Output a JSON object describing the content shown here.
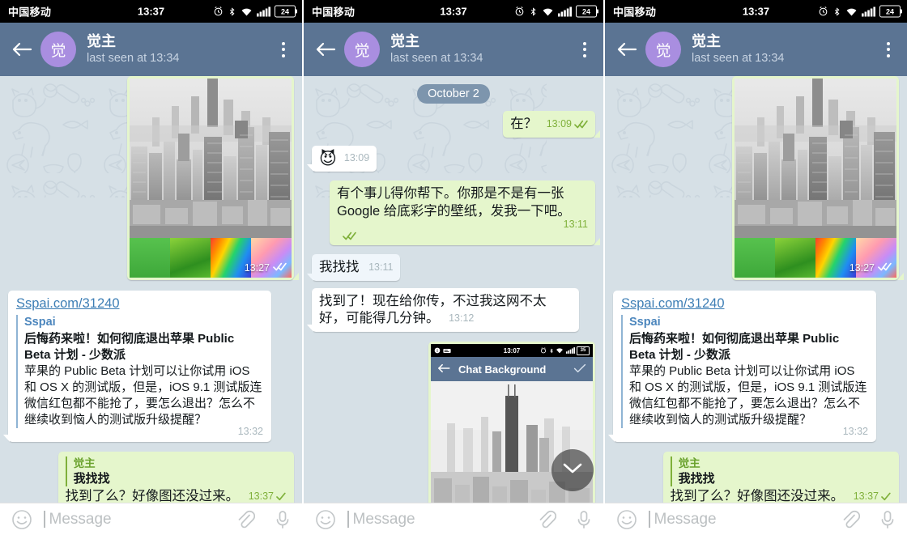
{
  "meta": {
    "app": "Telegram",
    "panels": 3,
    "colors": {
      "appbar": "#5b7493",
      "chat_bg": "#d6e0e6",
      "out_bubble": "#e5f6cc",
      "in_bubble": "#ffffff",
      "pale_bubble": "#f0f6fb",
      "avatar": "#a98ee0",
      "link_accent": "#4c86bd",
      "check_green": "#7fb03a",
      "date_chip": "#7d95ad"
    }
  },
  "statusbar": {
    "carrier": "中国移动",
    "time": "13:37",
    "battery": "24",
    "icons": [
      "alarm-icon",
      "bluetooth-icon",
      "wifi-icon",
      "signal-icon",
      "battery-icon"
    ]
  },
  "appbar": {
    "back": "back-arrow-icon",
    "avatar_initial": "觉",
    "name": "觉主",
    "status": "last seen at 13:34",
    "menu": "overflow-menu-icon"
  },
  "input": {
    "emoji_icon": "smiley-icon",
    "placeholder": "Message",
    "value": "",
    "attach_icon": "paperclip-icon",
    "voice_icon": "microphone-icon"
  },
  "panel1": {
    "photo_message": {
      "time": "13:27",
      "status": "read",
      "caption": "",
      "swatches": [
        "green-grass",
        "green-leaves",
        "rainbow-streaks",
        "pastel-prism"
      ]
    },
    "link_message": {
      "url": "Sspai.com/31240",
      "site": "Sspai",
      "title": "后悔药来啦！如何彻底退出苹果 Public Beta 计划 - 少数派",
      "description": "苹果的 Public Beta 计划可以让你试用 iOS 和 OS X 的测试版，但是，iOS 9.1 测试版连微信红包都不能抢了，要怎么退出？怎么不继续收到恼人的测试版升级提醒？",
      "time": "13:32"
    },
    "reply_message": {
      "quote_name": "觉主",
      "quote_text": "我找找",
      "text": "找到了么？好像图还没过来。",
      "time": "13:37",
      "status": "sent"
    }
  },
  "panel2": {
    "date_chip": "October 2",
    "messages": [
      {
        "id": "m1",
        "dir": "out",
        "text": "在？",
        "time": "13:09",
        "status": "read"
      },
      {
        "id": "m2",
        "dir": "in",
        "emoji": "😈",
        "time": "13:09"
      },
      {
        "id": "m3",
        "dir": "out",
        "text": "有个事儿得你帮下。你那是不是有一张 Google 给底彩字的壁纸，发我一下吧。",
        "time": "13:11",
        "status": "read"
      },
      {
        "id": "m4",
        "dir": "in",
        "text": "我找找",
        "time": "13:11"
      },
      {
        "id": "m5",
        "dir": "in",
        "text": "找到了！现在给你传，不过我这网不太好，可能得几分钟。",
        "time": "13:12"
      }
    ],
    "screenshot_message": {
      "inner_statusbar_time": "13:07",
      "inner_battery": "35",
      "inner_title": "Chat Background",
      "inner_back": "back-arrow-icon",
      "inner_confirm": "checkmark-icon"
    },
    "scroll_button": "chevron-down-icon"
  },
  "panel3": {
    "photo_message": {
      "time": "13:27",
      "status": "read"
    },
    "link_message": {
      "url": "Sspai.com/31240",
      "site": "Sspai",
      "title": "后悔药来啦！如何彻底退出苹果 Public Beta 计划 - 少数派",
      "description": "苹果的 Public Beta 计划可以让你试用 iOS 和 OS X 的测试版，但是，iOS 9.1 测试版连微信红包都不能抢了，要怎么退出？怎么不继续收到恼人的测试版升级提醒？",
      "time": "13:32"
    },
    "reply_message": {
      "quote_name": "觉主",
      "quote_text": "我找找",
      "text": "找到了么？好像图还没过来。",
      "time": "13:37",
      "status": "sent"
    }
  }
}
